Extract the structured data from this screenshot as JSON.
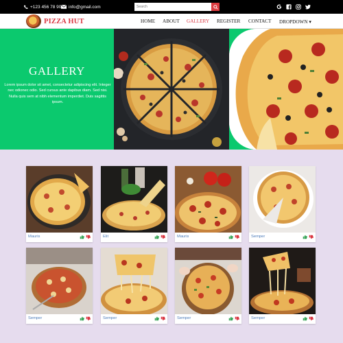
{
  "topbar": {
    "phone": "+123 456 78 90",
    "email": "info@gmail.com",
    "search_placeholder": "Search",
    "social": [
      "google-icon",
      "facebook-icon",
      "instagram-icon",
      "twitter-icon"
    ]
  },
  "brand": {
    "name": "PIZZA HUT"
  },
  "nav": {
    "items": [
      "HOME",
      "ABOUT",
      "GALLERY",
      "REGISTER",
      "CONTACT",
      "DROPDOWN"
    ],
    "active": "GALLERY",
    "dropdown_caret": "▾"
  },
  "hero": {
    "title": "GALLERY",
    "text": "Lorem ipsum dolor sit amet, consectetur adipiscing elit. Integer nec odionec odio. Sed cursus ante dapibus diam. Sed nisi. Nulla quis sem at nibh elementum imperdiet. Duis sagittis ipsum."
  },
  "gallery": [
    {
      "caption": "Mauris"
    },
    {
      "caption": "Elit"
    },
    {
      "caption": "Mauris"
    },
    {
      "caption": "Semper"
    },
    {
      "caption": "Semper"
    },
    {
      "caption": "Semper"
    },
    {
      "caption": "Semper"
    },
    {
      "caption": "Semper"
    }
  ],
  "colors": {
    "accent_red": "#d93641",
    "hero_green": "#0bc96e",
    "page_bg": "#e6dcee",
    "caption_blue": "#4a7ab8",
    "like_green": "#3aa55a",
    "dislike_red": "#d93641"
  }
}
